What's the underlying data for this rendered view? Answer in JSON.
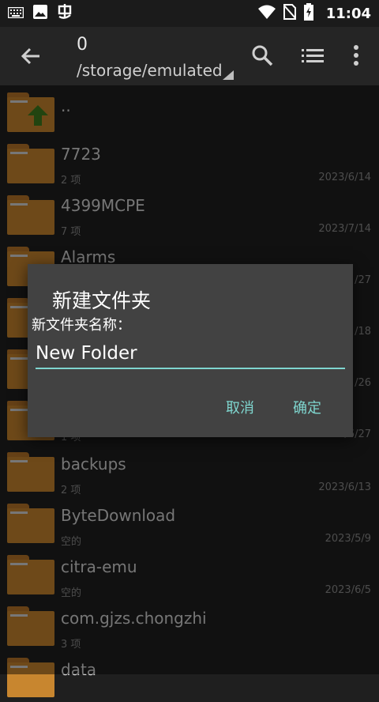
{
  "status_bar": {
    "time": "11:04"
  },
  "toolbar": {
    "count": "0",
    "path": "/storage/emulated"
  },
  "files": [
    {
      "name": "..",
      "sub": "",
      "date": ""
    },
    {
      "name": "7723",
      "sub": "2 项",
      "date": "2023/6/14"
    },
    {
      "name": "4399MCPE",
      "sub": "7 项",
      "date": "2023/7/14"
    },
    {
      "name": "Alarms",
      "sub": "",
      "date": "/27"
    },
    {
      "name": "",
      "sub": "",
      "date": "/18"
    },
    {
      "name": "",
      "sub": "",
      "date": "/26"
    },
    {
      "name": "",
      "sub": "1 项",
      "date": "2023/6/27"
    },
    {
      "name": "backups",
      "sub": "2 项",
      "date": "2023/6/13"
    },
    {
      "name": "ByteDownload",
      "sub": "空的",
      "date": "2023/5/9"
    },
    {
      "name": "citra-emu",
      "sub": "空的",
      "date": "2023/6/5"
    },
    {
      "name": "com.gjzs.chongzhi",
      "sub": "3 项",
      "date": ""
    },
    {
      "name": "data",
      "sub": "",
      "date": ""
    }
  ],
  "dialog": {
    "title": "新建文件夹",
    "label": "新文件夹名称：",
    "input_value": "New Folder",
    "cancel": "取消",
    "ok": "确定"
  }
}
